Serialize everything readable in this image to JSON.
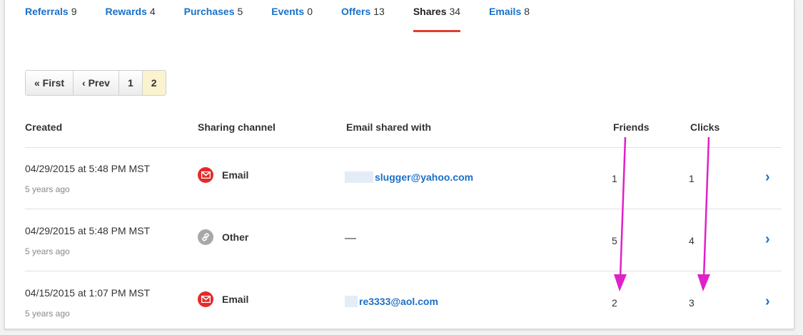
{
  "tabs": [
    {
      "label": "Referrals",
      "count": "9"
    },
    {
      "label": "Rewards",
      "count": "4"
    },
    {
      "label": "Purchases",
      "count": "5"
    },
    {
      "label": "Events",
      "count": "0"
    },
    {
      "label": "Offers",
      "count": "13"
    },
    {
      "label": "Shares",
      "count": "34",
      "active": true
    },
    {
      "label": "Emails",
      "count": "8"
    }
  ],
  "pagination": {
    "first": "« First",
    "prev": "‹ Prev",
    "pages": [
      "1",
      "2"
    ],
    "current": "2"
  },
  "table": {
    "headers": {
      "created": "Created",
      "channel": "Sharing channel",
      "email": "Email shared with",
      "friends": "Friends",
      "clicks": "Clicks"
    },
    "rows": [
      {
        "created": "04/29/2015 at 5:48 PM MST",
        "ago": "5 years ago",
        "channel": "Email",
        "channel_icon": "email-icon",
        "email": "slugger@yahoo.com",
        "friends": "1",
        "clicks": "1"
      },
      {
        "created": "04/29/2015 at 5:48 PM MST",
        "ago": "5 years ago",
        "channel": "Other",
        "channel_icon": "link-icon",
        "email": "—",
        "friends": "5",
        "clicks": "4"
      },
      {
        "created": "04/15/2015 at 1:07 PM MST",
        "ago": "5 years ago",
        "channel": "Email",
        "channel_icon": "email-icon",
        "email": "re3333@aol.com",
        "friends": "2",
        "clicks": "3"
      }
    ],
    "row_chevron": "›"
  },
  "annotation": {
    "arrow_color": "#e020c8"
  },
  "colors": {
    "link": "#1a70c8",
    "active_tab_underline": "#e33b2e",
    "email_icon": "#e52a2a"
  }
}
